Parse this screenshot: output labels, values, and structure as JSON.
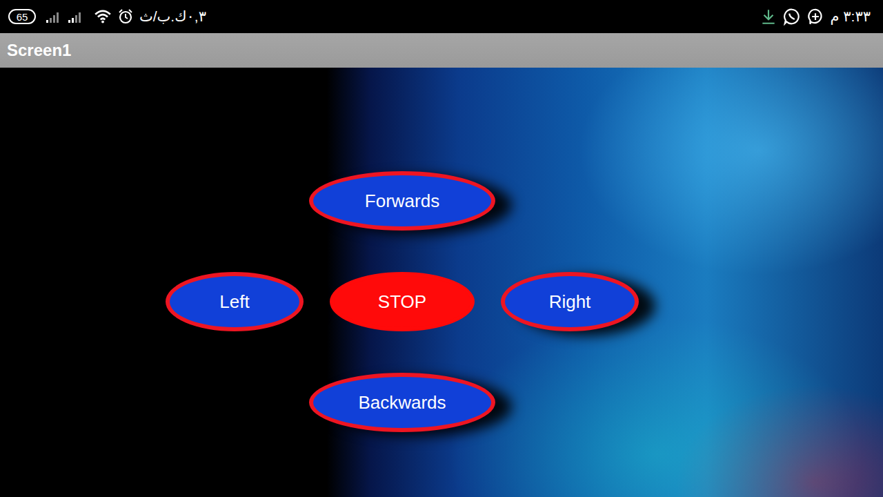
{
  "status_bar": {
    "battery": "65",
    "speed": "٠,٣ك.ب/ث",
    "time": "٣:٣٣ م"
  },
  "title_bar": {
    "title": "Screen1"
  },
  "rows": [
    {
      "buttons": [
        {
          "label": "Forwards",
          "kind": "direction"
        }
      ]
    },
    {
      "buttons": [
        {
          "label": "Left",
          "kind": "direction"
        },
        {
          "label": "STOP",
          "kind": "stop"
        },
        {
          "label": "Right",
          "kind": "direction"
        }
      ]
    },
    {
      "buttons": [
        {
          "label": "Backwards",
          "kind": "direction"
        }
      ]
    }
  ]
}
